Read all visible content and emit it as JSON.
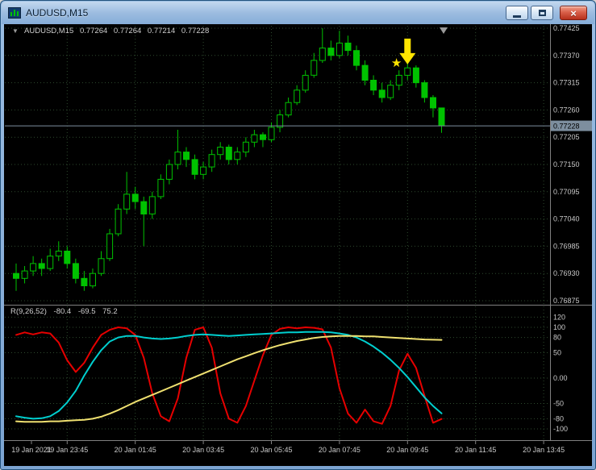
{
  "window": {
    "title": "AUDUSD,M15"
  },
  "icons": {
    "close_glyph": "×",
    "star_glyph": "★",
    "expander_glyph": "▼"
  },
  "chart_header": {
    "symbol": "AUDUSD,M15",
    "open": "0.77264",
    "high": "0.77264",
    "low": "0.77214",
    "close": "0.77228"
  },
  "indicator_panel": {
    "label": "R(9,26,52)",
    "values": [
      "-80.4",
      "-69.5",
      "75.2"
    ]
  },
  "colors": {
    "background": "#000000",
    "grid": "#2e4a2e",
    "candle": "#00c200",
    "axis_text": "#c9c9c9",
    "separator": "#808080",
    "price_line": "#7d8e9e",
    "red_line": "#e60000",
    "cyan_line": "#00cfcf",
    "yellow_line": "#efe070",
    "signal_yellow": "#ffe400"
  },
  "chart_data": {
    "type": "candlestick",
    "symbol": "AUDUSD",
    "timeframe": "M15",
    "title": "AUDUSD,M15",
    "price_axis_labels": [
      "0.77425",
      "0.77370",
      "0.77315",
      "0.77260",
      "0.77205",
      "0.77150",
      "0.77095",
      "0.77040",
      "0.76985",
      "0.76930",
      "0.76875"
    ],
    "current_price": 0.77228,
    "current_price_label": "0.77228",
    "time_labels": [
      {
        "text": "19 Jan 2021",
        "i": 1.8
      },
      {
        "text": "19 Jan 23:45",
        "i": 6
      },
      {
        "text": "20 Jan 01:45",
        "i": 14
      },
      {
        "text": "20 Jan 03:45",
        "i": 22
      },
      {
        "text": "20 Jan 05:45",
        "i": 30
      },
      {
        "text": "20 Jan 07:45",
        "i": 38
      },
      {
        "text": "20 Jan 09:45",
        "i": 46
      },
      {
        "text": "20 Jan 11:45",
        "i": 54
      },
      {
        "text": "20 Jan 13:45",
        "i": 62
      }
    ],
    "ohlc": [
      [
        0.7693,
        0.7695,
        0.76895,
        0.7692
      ],
      [
        0.7692,
        0.76945,
        0.7691,
        0.76935
      ],
      [
        0.76935,
        0.76965,
        0.76925,
        0.7695
      ],
      [
        0.7695,
        0.7696,
        0.76925,
        0.7694
      ],
      [
        0.7694,
        0.7698,
        0.76935,
        0.76965
      ],
      [
        0.76965,
        0.76995,
        0.76955,
        0.76975
      ],
      [
        0.76975,
        0.76985,
        0.7694,
        0.7695
      ],
      [
        0.7695,
        0.7696,
        0.7691,
        0.7692
      ],
      [
        0.7692,
        0.76935,
        0.76895,
        0.76905
      ],
      [
        0.76905,
        0.7694,
        0.769,
        0.7693
      ],
      [
        0.7693,
        0.76975,
        0.76925,
        0.7696
      ],
      [
        0.7696,
        0.7702,
        0.76955,
        0.7701
      ],
      [
        0.7701,
        0.7707,
        0.77005,
        0.7706
      ],
      [
        0.7706,
        0.77135,
        0.7705,
        0.7709
      ],
      [
        0.7709,
        0.77105,
        0.7706,
        0.77075
      ],
      [
        0.77075,
        0.77085,
        0.76985,
        0.7705
      ],
      [
        0.7705,
        0.77095,
        0.7704,
        0.77085
      ],
      [
        0.77085,
        0.7713,
        0.7708,
        0.7712
      ],
      [
        0.7712,
        0.7716,
        0.7711,
        0.7715
      ],
      [
        0.7715,
        0.7722,
        0.7714,
        0.77175
      ],
      [
        0.77175,
        0.77185,
        0.77145,
        0.7716
      ],
      [
        0.7716,
        0.7717,
        0.7712,
        0.7713
      ],
      [
        0.7713,
        0.77155,
        0.7712,
        0.77145
      ],
      [
        0.77145,
        0.7718,
        0.77135,
        0.7717
      ],
      [
        0.7717,
        0.77195,
        0.7716,
        0.77185
      ],
      [
        0.77185,
        0.7719,
        0.7715,
        0.7716
      ],
      [
        0.7716,
        0.77185,
        0.7715,
        0.77175
      ],
      [
        0.77175,
        0.77205,
        0.77165,
        0.77195
      ],
      [
        0.77195,
        0.7722,
        0.77185,
        0.7721
      ],
      [
        0.7721,
        0.77215,
        0.77185,
        0.772
      ],
      [
        0.772,
        0.77235,
        0.77195,
        0.77225
      ],
      [
        0.77225,
        0.7726,
        0.77215,
        0.7725
      ],
      [
        0.7725,
        0.77285,
        0.77245,
        0.77275
      ],
      [
        0.77275,
        0.7731,
        0.7727,
        0.773
      ],
      [
        0.773,
        0.7734,
        0.77295,
        0.7733
      ],
      [
        0.7733,
        0.77375,
        0.77325,
        0.7736
      ],
      [
        0.7736,
        0.77425,
        0.77355,
        0.77385
      ],
      [
        0.77385,
        0.774,
        0.7736,
        0.7737
      ],
      [
        0.7737,
        0.7742,
        0.77365,
        0.77395
      ],
      [
        0.77395,
        0.7741,
        0.7737,
        0.7738
      ],
      [
        0.7738,
        0.7739,
        0.7734,
        0.7735
      ],
      [
        0.7735,
        0.7736,
        0.7731,
        0.7732
      ],
      [
        0.7732,
        0.7733,
        0.7729,
        0.773
      ],
      [
        0.773,
        0.77315,
        0.77275,
        0.77285
      ],
      [
        0.77285,
        0.7732,
        0.7728,
        0.7731
      ],
      [
        0.7731,
        0.7734,
        0.773,
        0.7733
      ],
      [
        0.7733,
        0.77365,
        0.7732,
        0.77345
      ],
      [
        0.77345,
        0.7735,
        0.77305,
        0.77315
      ],
      [
        0.77315,
        0.7732,
        0.77275,
        0.77285
      ],
      [
        0.77285,
        0.7729,
        0.77245,
        0.77264
      ],
      [
        0.77264,
        0.77264,
        0.77214,
        0.77228
      ]
    ],
    "indicator": {
      "name": "R(9,26,52)",
      "scale_labels": [
        "120",
        "100",
        "80",
        "50",
        "0.00",
        "-50",
        "-80",
        "-100"
      ],
      "series": [
        {
          "name": "fast",
          "color_key": "red_line",
          "values": [
            85,
            90,
            86,
            90,
            88,
            70,
            35,
            12,
            30,
            60,
            85,
            95,
            100,
            98,
            85,
            40,
            -30,
            -75,
            -85,
            -40,
            40,
            95,
            100,
            60,
            -30,
            -80,
            -88,
            -55,
            -5,
            45,
            85,
            97,
            100,
            98,
            100,
            99,
            96,
            60,
            -20,
            -70,
            -88,
            -62,
            -85,
            -90,
            -55,
            15,
            48,
            20,
            -35,
            -88,
            -80.4
          ]
        },
        {
          "name": "medium",
          "color_key": "cyan_line",
          "values": [
            -75,
            -78,
            -80,
            -79,
            -75,
            -65,
            -48,
            -25,
            5,
            32,
            55,
            72,
            80,
            83,
            83,
            80,
            78,
            77,
            78,
            80,
            83,
            85,
            86,
            85,
            84,
            83,
            84,
            85,
            86,
            87,
            88,
            89,
            90,
            90,
            91,
            91,
            91,
            90,
            88,
            85,
            80,
            72,
            62,
            50,
            36,
            20,
            2,
            -18,
            -38,
            -55,
            -69.5
          ]
        },
        {
          "name": "slow",
          "color_key": "yellow_line",
          "values": [
            -85,
            -86,
            -86,
            -86,
            -85,
            -85,
            -84,
            -83,
            -82,
            -80,
            -76,
            -70,
            -63,
            -55,
            -47,
            -40,
            -33,
            -26,
            -19,
            -12,
            -5,
            2,
            9,
            16,
            23,
            30,
            37,
            43,
            49,
            55,
            60,
            65,
            69,
            73,
            76,
            79,
            81,
            82,
            83,
            83,
            83,
            82,
            82,
            81,
            80,
            79,
            78,
            77,
            76,
            75.5,
            75.2
          ]
        }
      ]
    },
    "annotations": [
      {
        "type": "arrow-down",
        "candle_index": 46,
        "price": 0.77352,
        "color": "#ffe400"
      },
      {
        "type": "star",
        "candle_index": 44.7,
        "price": 0.77355,
        "color": "#ffe400"
      }
    ]
  }
}
